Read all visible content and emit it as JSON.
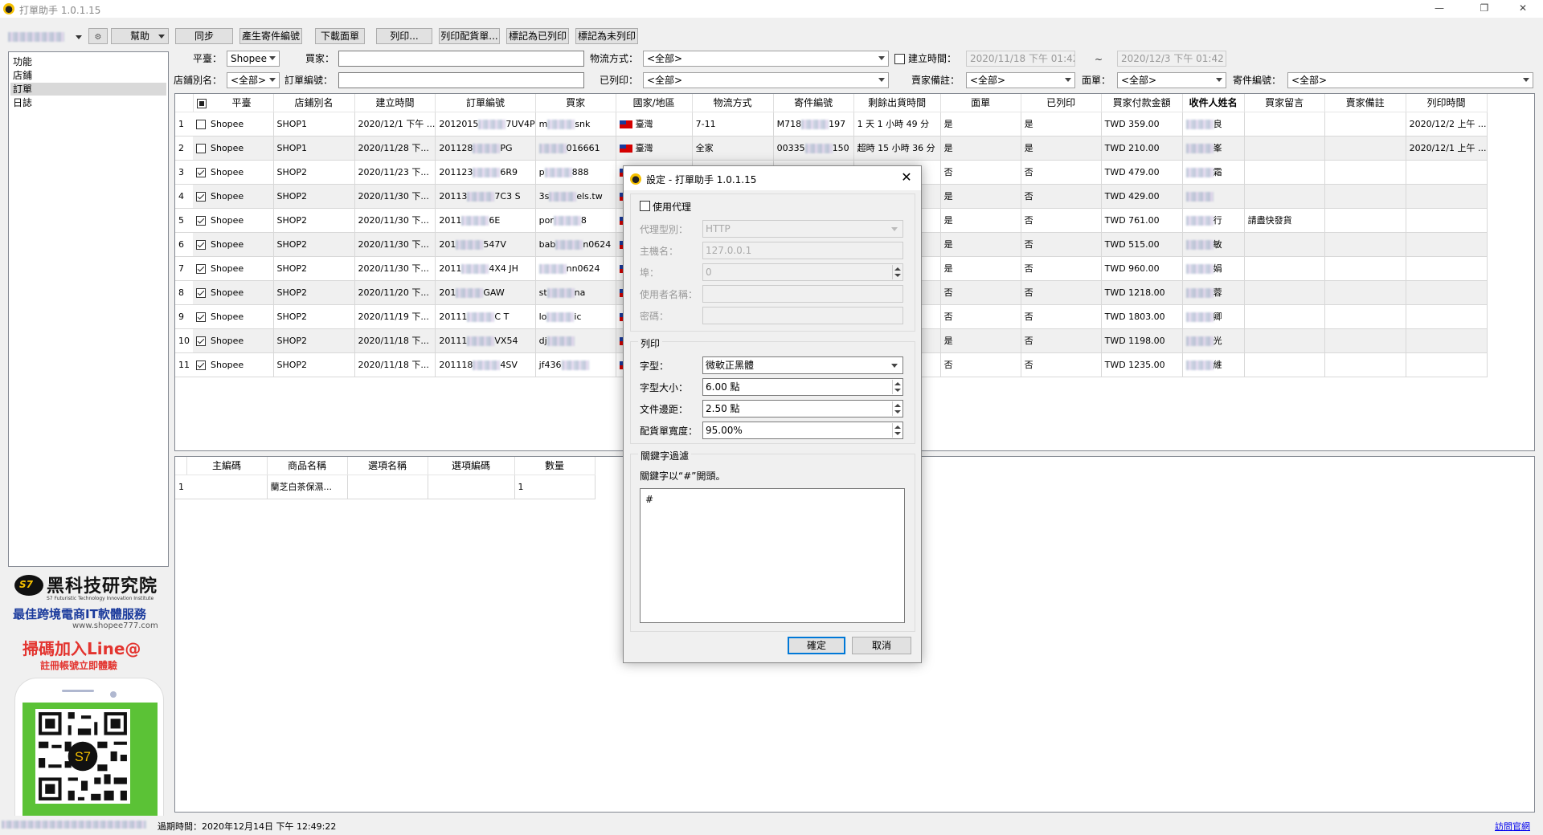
{
  "window": {
    "title": "打單助手 1.0.1.15",
    "controls": [
      "minimize-icon",
      "restore-icon",
      "close-icon"
    ]
  },
  "toolbar": {
    "account_dropdown": "",
    "help_label": "幫助",
    "buttons": [
      "同步",
      "產生寄件編號",
      "下載面單",
      "列印...",
      "列印配貨單...",
      "標記為已列印",
      "標記為未列印"
    ]
  },
  "filters": {
    "platform_label": "平臺：",
    "platform_value": "Shopee",
    "buyer_label": "買家：",
    "buyer_value": "",
    "logistics_label": "物流方式：",
    "logistics_value": "<全部>",
    "created_label": "建立時間：",
    "created_from": "2020/11/18 下午 01:42",
    "created_sep": "~",
    "created_to": "2020/12/3 下午 01:42",
    "store_label": "店鋪別名：",
    "store_value": "<全部>",
    "order_label": "訂單編號：",
    "order_value": "",
    "printed_label": "已列印：",
    "printed_value": "<全部>",
    "seller_note_label": "賣家備註：",
    "seller_note_value": "<全部>",
    "waybill_label": "面單：",
    "waybill_value": "<全部>",
    "tracking_label": "寄件編號：",
    "tracking_value": "<全部>"
  },
  "sidebar": {
    "items": [
      "功能",
      "店鋪",
      "訂單",
      "日誌"
    ],
    "selected": "訂單"
  },
  "orders": {
    "columns": [
      "平臺",
      "店鋪別名",
      "建立時間",
      "訂單編號",
      "買家",
      "國家/地區",
      "物流方式",
      "寄件編號",
      "剩餘出貨時間",
      "面單",
      "已列印",
      "買家付款金額",
      "收件人姓名",
      "買家留言",
      "賣家備註",
      "列印時間"
    ],
    "rows": [
      {
        "n": "1",
        "checked": false,
        "platform": "Shopee",
        "store": "SHOP1",
        "created": "2020/12/1 下午 ...",
        "order": "2012015",
        "order_tail": "7UV4P",
        "buyer": "m",
        "buyer_tail": "snk",
        "country": "臺灣",
        "logistics": "7-11",
        "tracking": "M718",
        "tracking_tail": "197",
        "remaining": "1 天 1 小時 49 分",
        "waybill": "是",
        "printed": "是",
        "amount": "TWD 359.00",
        "recipient": "良",
        "message": "",
        "seller_note": "",
        "print_time": "2020/12/2 上午 ..."
      },
      {
        "n": "2",
        "checked": false,
        "platform": "Shopee",
        "store": "SHOP1",
        "created": "2020/11/28 下...",
        "order": "201128",
        "order_tail": "PG",
        "buyer": "",
        "buyer_tail": "016661",
        "country": "臺灣",
        "logistics": "全家",
        "tracking": "00335",
        "tracking_tail": "150",
        "remaining": "超時 15 小時 36 分",
        "waybill": "是",
        "printed": "是",
        "amount": "TWD 210.00",
        "recipient": "峯",
        "message": "",
        "seller_note": "",
        "print_time": "2020/12/1 上午 ..."
      },
      {
        "n": "3",
        "checked": true,
        "platform": "Shopee",
        "store": "SHOP2",
        "created": "2020/11/23 下...",
        "order": "201123",
        "order_tail": "6R9",
        "buyer": "p",
        "buyer_tail": "888",
        "country": "",
        "logistics": "",
        "tracking": "",
        "tracking_tail": "",
        "remaining": "",
        "waybill": "否",
        "printed": "否",
        "amount": "TWD 479.00",
        "recipient": "霜",
        "message": "",
        "seller_note": "",
        "print_time": ""
      },
      {
        "n": "4",
        "checked": true,
        "platform": "Shopee",
        "store": "SHOP2",
        "created": "2020/11/30 下...",
        "order": "20113",
        "order_tail": "7C3 S",
        "buyer": "3s",
        "buyer_tail": "els.tw",
        "country": "",
        "logistics": "",
        "tracking": "",
        "tracking_tail": "",
        "remaining": "分",
        "waybill": "是",
        "printed": "否",
        "amount": "TWD 429.00",
        "recipient": "",
        "message": "",
        "seller_note": "",
        "print_time": ""
      },
      {
        "n": "5",
        "checked": true,
        "platform": "Shopee",
        "store": "SHOP2",
        "created": "2020/11/30 下...",
        "order": "2011",
        "order_tail": "6E",
        "buyer": "por",
        "buyer_tail": "8",
        "country": "",
        "logistics": "",
        "tracking": "",
        "tracking_tail": "",
        "remaining": "分",
        "waybill": "是",
        "printed": "否",
        "amount": "TWD 761.00",
        "recipient": "行",
        "message": "請盡快發貨",
        "seller_note": "",
        "print_time": ""
      },
      {
        "n": "6",
        "checked": true,
        "platform": "Shopee",
        "store": "SHOP2",
        "created": "2020/11/30 下...",
        "order": "201",
        "order_tail": "547V",
        "buyer": "bab",
        "buyer_tail": "n0624",
        "country": "",
        "logistics": "",
        "tracking": "",
        "tracking_tail": "",
        "remaining": "分",
        "waybill": "是",
        "printed": "否",
        "amount": "TWD 515.00",
        "recipient": "敏",
        "message": "",
        "seller_note": "",
        "print_time": ""
      },
      {
        "n": "7",
        "checked": true,
        "platform": "Shopee",
        "store": "SHOP2",
        "created": "2020/11/30 下...",
        "order": "2011",
        "order_tail": "4X4 JH",
        "buyer": "",
        "buyer_tail": "nn0624",
        "country": "",
        "logistics": "",
        "tracking": "",
        "tracking_tail": "",
        "remaining": "分",
        "waybill": "是",
        "printed": "否",
        "amount": "TWD 960.00",
        "recipient": "娟",
        "message": "",
        "seller_note": "",
        "print_time": ""
      },
      {
        "n": "8",
        "checked": true,
        "platform": "Shopee",
        "store": "SHOP2",
        "created": "2020/11/20 下...",
        "order": "201",
        "order_tail": "GAW",
        "buyer": "st",
        "buyer_tail": "na",
        "country": "",
        "logistics": "",
        "tracking": "",
        "tracking_tail": "",
        "remaining": "",
        "waybill": "否",
        "printed": "否",
        "amount": "TWD 1218.00",
        "recipient": "蓉",
        "message": "",
        "seller_note": "",
        "print_time": ""
      },
      {
        "n": "9",
        "checked": true,
        "platform": "Shopee",
        "store": "SHOP2",
        "created": "2020/11/19 下...",
        "order": "20111",
        "order_tail": "C T",
        "buyer": "lo",
        "buyer_tail": "ic",
        "country": "",
        "logistics": "",
        "tracking": "",
        "tracking_tail": "",
        "remaining": "分",
        "waybill": "否",
        "printed": "否",
        "amount": "TWD 1803.00",
        "recipient": "卿",
        "message": "",
        "seller_note": "",
        "print_time": ""
      },
      {
        "n": "10",
        "checked": true,
        "platform": "Shopee",
        "store": "SHOP2",
        "created": "2020/11/18 下...",
        "order": "20111",
        "order_tail": "VX54",
        "buyer": "dj",
        "buyer_tail": "",
        "country": "",
        "logistics": "",
        "tracking": "",
        "tracking_tail": "",
        "remaining": "",
        "waybill": "是",
        "printed": "否",
        "amount": "TWD 1198.00",
        "recipient": "光",
        "message": "",
        "seller_note": "",
        "print_time": ""
      },
      {
        "n": "11",
        "checked": true,
        "platform": "Shopee",
        "store": "SHOP2",
        "created": "2020/11/18 下...",
        "order": "201118",
        "order_tail": "4SV",
        "buyer": "jf436",
        "buyer_tail": "",
        "country": "",
        "logistics": "",
        "tracking": "",
        "tracking_tail": "",
        "remaining": "",
        "waybill": "否",
        "printed": "否",
        "amount": "TWD 1235.00",
        "recipient": "維",
        "message": "",
        "seller_note": "",
        "print_time": ""
      }
    ]
  },
  "items": {
    "columns": [
      "主編碼",
      "商品名稱",
      "選項名稱",
      "選項編碼",
      "數量"
    ],
    "rows": [
      {
        "n": "1",
        "sku": "",
        "name": "蘭芝白茶保濕...",
        "option": "",
        "option_code": "",
        "qty": "1"
      }
    ]
  },
  "ad": {
    "badge": "S7",
    "title": "黑科技研究院",
    "subtitle": "S7 Futuristic Technology Innovation Institute",
    "line1": "最佳跨境電商IT軟體服務",
    "url": "www.shopee777.com",
    "line2": "掃碼加入Line@",
    "line3": "註冊帳號立即體驗"
  },
  "status": {
    "expiry": "過期時間：2020年12月14日 下午 12:49:22",
    "link": "訪問官網"
  },
  "dialog": {
    "title": "設定 - 打單助手 1.0.1.15",
    "use_proxy_label": "使用代理",
    "use_proxy_checked": false,
    "proxy_type_label": "代理型別：",
    "proxy_type_value": "HTTP",
    "host_label": "主機名：",
    "host_value": "127.0.0.1",
    "port_label": "埠：",
    "port_value": "0",
    "username_label": "使用者名稱：",
    "username_value": "",
    "password_label": "密碼：",
    "password_value": "",
    "print_group": "列印",
    "font_label": "字型：",
    "font_value": "微軟正黑體",
    "font_size_label": "字型大小：",
    "font_size_value": "6.00 點",
    "margin_label": "文件邊距：",
    "margin_value": "2.50 點",
    "width_label": "配貨單寬度：",
    "width_value": "95.00%",
    "keyword_group": "關鍵字過濾",
    "keyword_hint": "關鍵字以“#”開頭。",
    "keyword_text": "#",
    "ok_label": "確定",
    "cancel_label": "取消"
  }
}
